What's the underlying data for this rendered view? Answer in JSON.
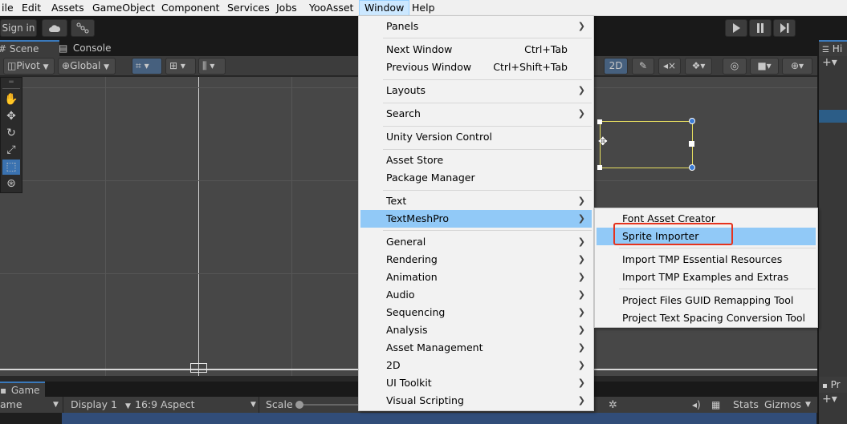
{
  "menubar": {
    "items": [
      "ile",
      "Edit",
      "Assets",
      "GameObject",
      "Component",
      "Services",
      "Jobs",
      "YooAsset",
      "Window",
      "Help"
    ]
  },
  "toolbar": {
    "sign_in_label": "Sign in"
  },
  "scene": {
    "tabs": [
      "Scene",
      "Console"
    ],
    "pivot_label": "Pivot",
    "global_label": "Global",
    "mode_2d_label": "2D"
  },
  "game": {
    "tab_label": "Game",
    "view_label": "ame",
    "display_label": "Display 1",
    "aspect_label": "16:9 Aspect",
    "scale_label": "Scale",
    "stats_label": "Stats",
    "gizmos_label": "Gizmos"
  },
  "right_panel": {
    "hierarchy_tab": "Hi",
    "project_tab": "Pr"
  },
  "window_menu": {
    "items": [
      {
        "label": "Panels",
        "shortcut": "",
        "submenu": true
      },
      {
        "label": "Next Window",
        "shortcut": "Ctrl+Tab",
        "submenu": false
      },
      {
        "label": "Previous Window",
        "shortcut": "Ctrl+Shift+Tab",
        "submenu": false
      },
      {
        "label": "Layouts",
        "shortcut": "",
        "submenu": true
      },
      {
        "label": "Search",
        "shortcut": "",
        "submenu": true
      },
      {
        "label": "Unity Version Control",
        "shortcut": "",
        "submenu": false
      },
      {
        "label": "Asset Store",
        "shortcut": "",
        "submenu": false
      },
      {
        "label": "Package Manager",
        "shortcut": "",
        "submenu": false
      },
      {
        "label": "Text",
        "shortcut": "",
        "submenu": true
      },
      {
        "label": "TextMeshPro",
        "shortcut": "",
        "submenu": true
      },
      {
        "label": "General",
        "shortcut": "",
        "submenu": true
      },
      {
        "label": "Rendering",
        "shortcut": "",
        "submenu": true
      },
      {
        "label": "Animation",
        "shortcut": "",
        "submenu": true
      },
      {
        "label": "Audio",
        "shortcut": "",
        "submenu": true
      },
      {
        "label": "Sequencing",
        "shortcut": "",
        "submenu": true
      },
      {
        "label": "Analysis",
        "shortcut": "",
        "submenu": true
      },
      {
        "label": "Asset Management",
        "shortcut": "",
        "submenu": true
      },
      {
        "label": "2D",
        "shortcut": "",
        "submenu": true
      },
      {
        "label": "UI Toolkit",
        "shortcut": "",
        "submenu": true
      },
      {
        "label": "Visual Scripting",
        "shortcut": "",
        "submenu": true
      }
    ],
    "highlighted": "TextMeshPro"
  },
  "textmeshpro_menu": {
    "items": [
      {
        "label": "Font Asset Creator"
      },
      {
        "label": "Sprite Importer"
      },
      {
        "label": "Import TMP Essential Resources"
      },
      {
        "label": "Import TMP Examples and Extras"
      },
      {
        "label": "Project Files GUID Remapping Tool"
      },
      {
        "label": "Project Text Spacing Conversion Tool"
      }
    ],
    "highlighted": "Sprite Importer"
  },
  "colors": {
    "menu_highlight": "#91c9f7",
    "annotation_red": "#e5331e",
    "selection_blue": "#3a72b0"
  }
}
